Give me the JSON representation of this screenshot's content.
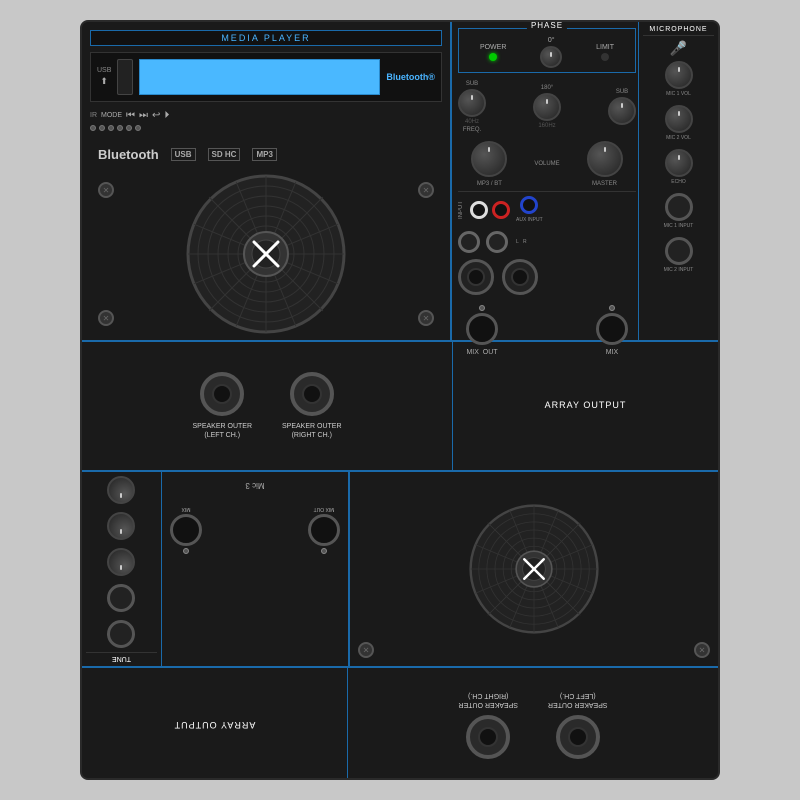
{
  "device": {
    "background_color": "#1a1a1a",
    "accent_color": "#1a6aaa",
    "border_color": "#2a2a2a"
  },
  "media_player": {
    "label": "MEDIA PLAYER",
    "usb_label": "USB",
    "bluetooth_label": "Bluetooth®",
    "ir_label": "IR",
    "mode_label": "MODE",
    "brand_logos": [
      "Bluetooth",
      "USB",
      "SD HC",
      "MP3"
    ],
    "lcd_color": "#4ab8ff"
  },
  "phase": {
    "title": "PHASE",
    "power_label": "POWER",
    "zero_label": "0°",
    "limit_label": "LIMIT",
    "phase180_label": "180°"
  },
  "controls": {
    "sub_label": "SUB",
    "freq_label": "FREQ.",
    "volume_label": "VOLUME",
    "mp3_bt_label": "MP3 / BT",
    "master_label": "MASTER",
    "hz40_label": "40Hz",
    "hz160_label": "160Hz",
    "input_label": "INPUT",
    "aux_input_label": "AUX INPUT",
    "mix_label": "MIX",
    "out_label": "OUT",
    "mix_out_label": "MIX"
  },
  "microphone": {
    "title": "MICROPHONE",
    "mic1_vol_label": "MIC 1 VOL",
    "mic2_vol_label": "MIC 2 VOL",
    "echo_label": "ECHO",
    "mic1_input_label": "MIC 1 INPUT",
    "mic2_input_label": "MIC 2 INPUT"
  },
  "speaker_output": {
    "array_output_label": "ARRAY OUTPUT",
    "speaker_outer_left_label": "SPEAKER OUTER",
    "speaker_outer_left_ch": "(LEFT CH.)",
    "speaker_outer_right_label": "SPEAKER OUTER",
    "speaker_outer_right_ch": "(RIGHT CH.)"
  },
  "bottom": {
    "mic3_label": "Mic 3"
  }
}
